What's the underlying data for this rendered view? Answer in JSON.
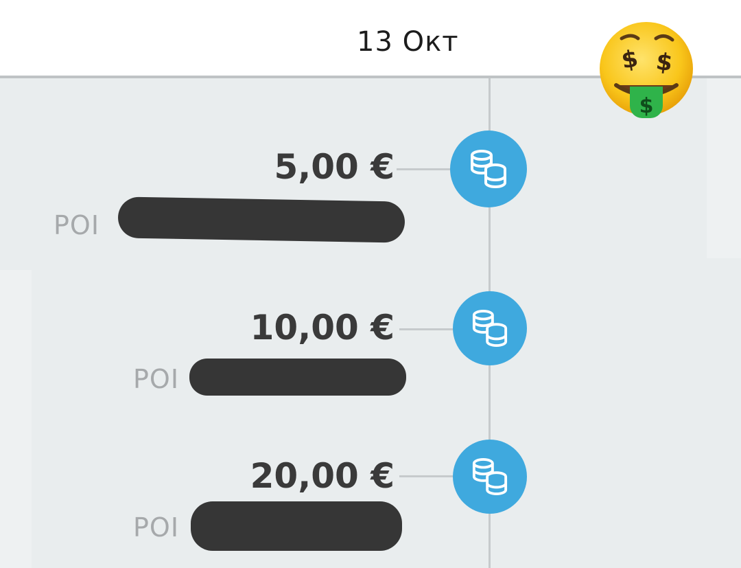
{
  "header": {
    "date": "13 Окт",
    "emoji": "money-mouth-face-icon"
  },
  "entries": [
    {
      "amount": "5,00 €",
      "label": "POI",
      "icon": "coins-icon",
      "detail_redacted": true
    },
    {
      "amount": "10,00 €",
      "label": "POI",
      "icon": "coins-icon",
      "detail_redacted": true
    },
    {
      "amount": "20,00 €",
      "label": "POI",
      "icon": "coins-icon",
      "detail_redacted": true
    }
  ],
  "colors": {
    "accent": "#3fa9de",
    "background": "#e9edee",
    "amount_text": "#3a3a3a",
    "label_text": "#a6a9ab",
    "redaction": "#363636"
  }
}
